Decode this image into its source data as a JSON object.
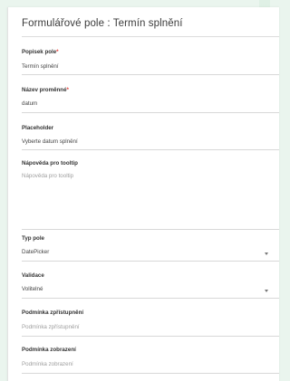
{
  "panel": {
    "title": "Formulářové pole : Termín splnění"
  },
  "fields": {
    "popisek": {
      "label": "Popisek pole",
      "required_mark": "*",
      "value": "Termín splnění"
    },
    "nazev": {
      "label": "Název proměnné",
      "required_mark": "*",
      "value": "datum"
    },
    "placeholder": {
      "label": "Placeholder",
      "value": "Vyberte datum splnění"
    },
    "napoveda": {
      "label": "Nápověda pro tooltip",
      "placeholder": "Nápověda pro tooltip"
    },
    "typ": {
      "label": "Typ pole",
      "value": "DatePicker"
    },
    "validace": {
      "label": "Validace",
      "value": "Volitelné"
    },
    "podminka_zpristupneni": {
      "label": "Podmínka zpřístupnění",
      "placeholder": "Podmínka zpřístupnění"
    },
    "podminka_zobrazeni": {
      "label": "Podmínka zobrazení",
      "placeholder": "Podmínka zobrazení"
    }
  },
  "colors": {
    "required": "#e53935",
    "page_background": "#eaf5ee"
  },
  "icons": {
    "dropdown": "chevron-down-icon"
  }
}
